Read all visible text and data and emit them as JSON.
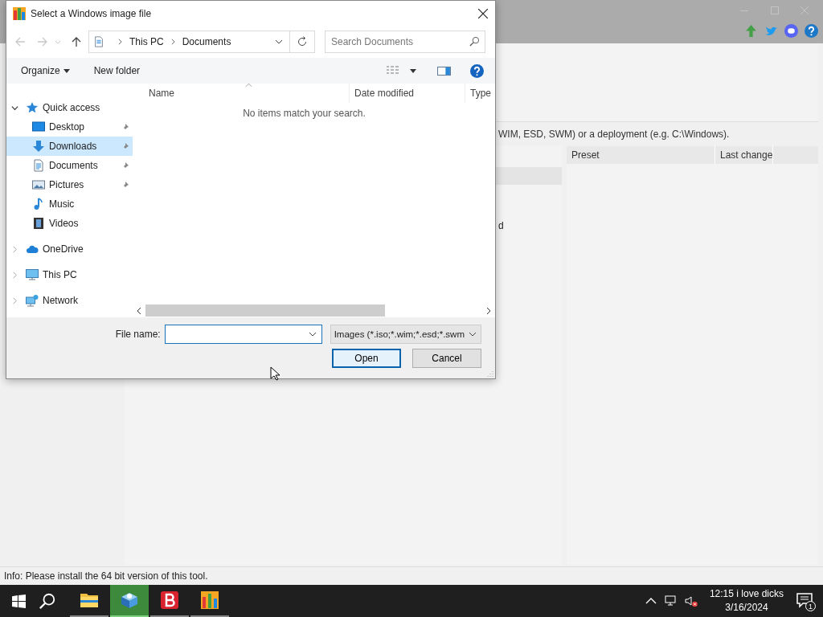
{
  "background": {
    "hint": "WIM, ESD, SWM) or a deployment (e.g. C:\\Windows).",
    "fragment": "d",
    "columns": [
      "Preset",
      "Last change"
    ],
    "status": "Info: Please install the 64 bit version of this tool."
  },
  "dialog": {
    "title": "Select a Windows image file",
    "breadcrumb": [
      "This PC",
      "Documents"
    ],
    "search": {
      "placeholder": "Search Documents"
    },
    "organize": "Organize",
    "new_folder": "New folder",
    "nav": [
      {
        "label": "Quick access",
        "kind": "star",
        "expanded": true,
        "selected": false,
        "children": [
          {
            "label": "Desktop",
            "kind": "desktop",
            "pinned": true,
            "selected": false
          },
          {
            "label": "Downloads",
            "kind": "download",
            "pinned": true,
            "selected": true
          },
          {
            "label": "Documents",
            "kind": "document",
            "pinned": true,
            "selected": false
          },
          {
            "label": "Pictures",
            "kind": "pictures",
            "pinned": true,
            "selected": false
          },
          {
            "label": "Music",
            "kind": "music",
            "pinned": false,
            "selected": false
          },
          {
            "label": "Videos",
            "kind": "videos",
            "pinned": false,
            "selected": false
          }
        ]
      },
      {
        "label": "OneDrive",
        "kind": "cloud",
        "expanded": false,
        "selected": false
      },
      {
        "label": "This PC",
        "kind": "pc",
        "expanded": false,
        "selected": false
      },
      {
        "label": "Network",
        "kind": "network",
        "expanded": false,
        "selected": false
      }
    ],
    "columns": [
      "Name",
      "Date modified",
      "Type"
    ],
    "empty_message": "No items match your search.",
    "file_name_label": "File name:",
    "file_type": "Images (*.iso;*.wim;*.esd;*.swm",
    "buttons": [
      {
        "label": "Open",
        "default": true
      },
      {
        "label": "Cancel",
        "default": false
      }
    ]
  },
  "taskbar": {
    "apps": [
      {
        "kind": "folder",
        "active": false
      },
      {
        "kind": "box",
        "active": true
      },
      {
        "kind": "letter-b",
        "active": false
      },
      {
        "kind": "chart",
        "active": false
      }
    ],
    "time": "12:15 i love dicks",
    "date": "3/16/2024",
    "notifications": "1"
  }
}
